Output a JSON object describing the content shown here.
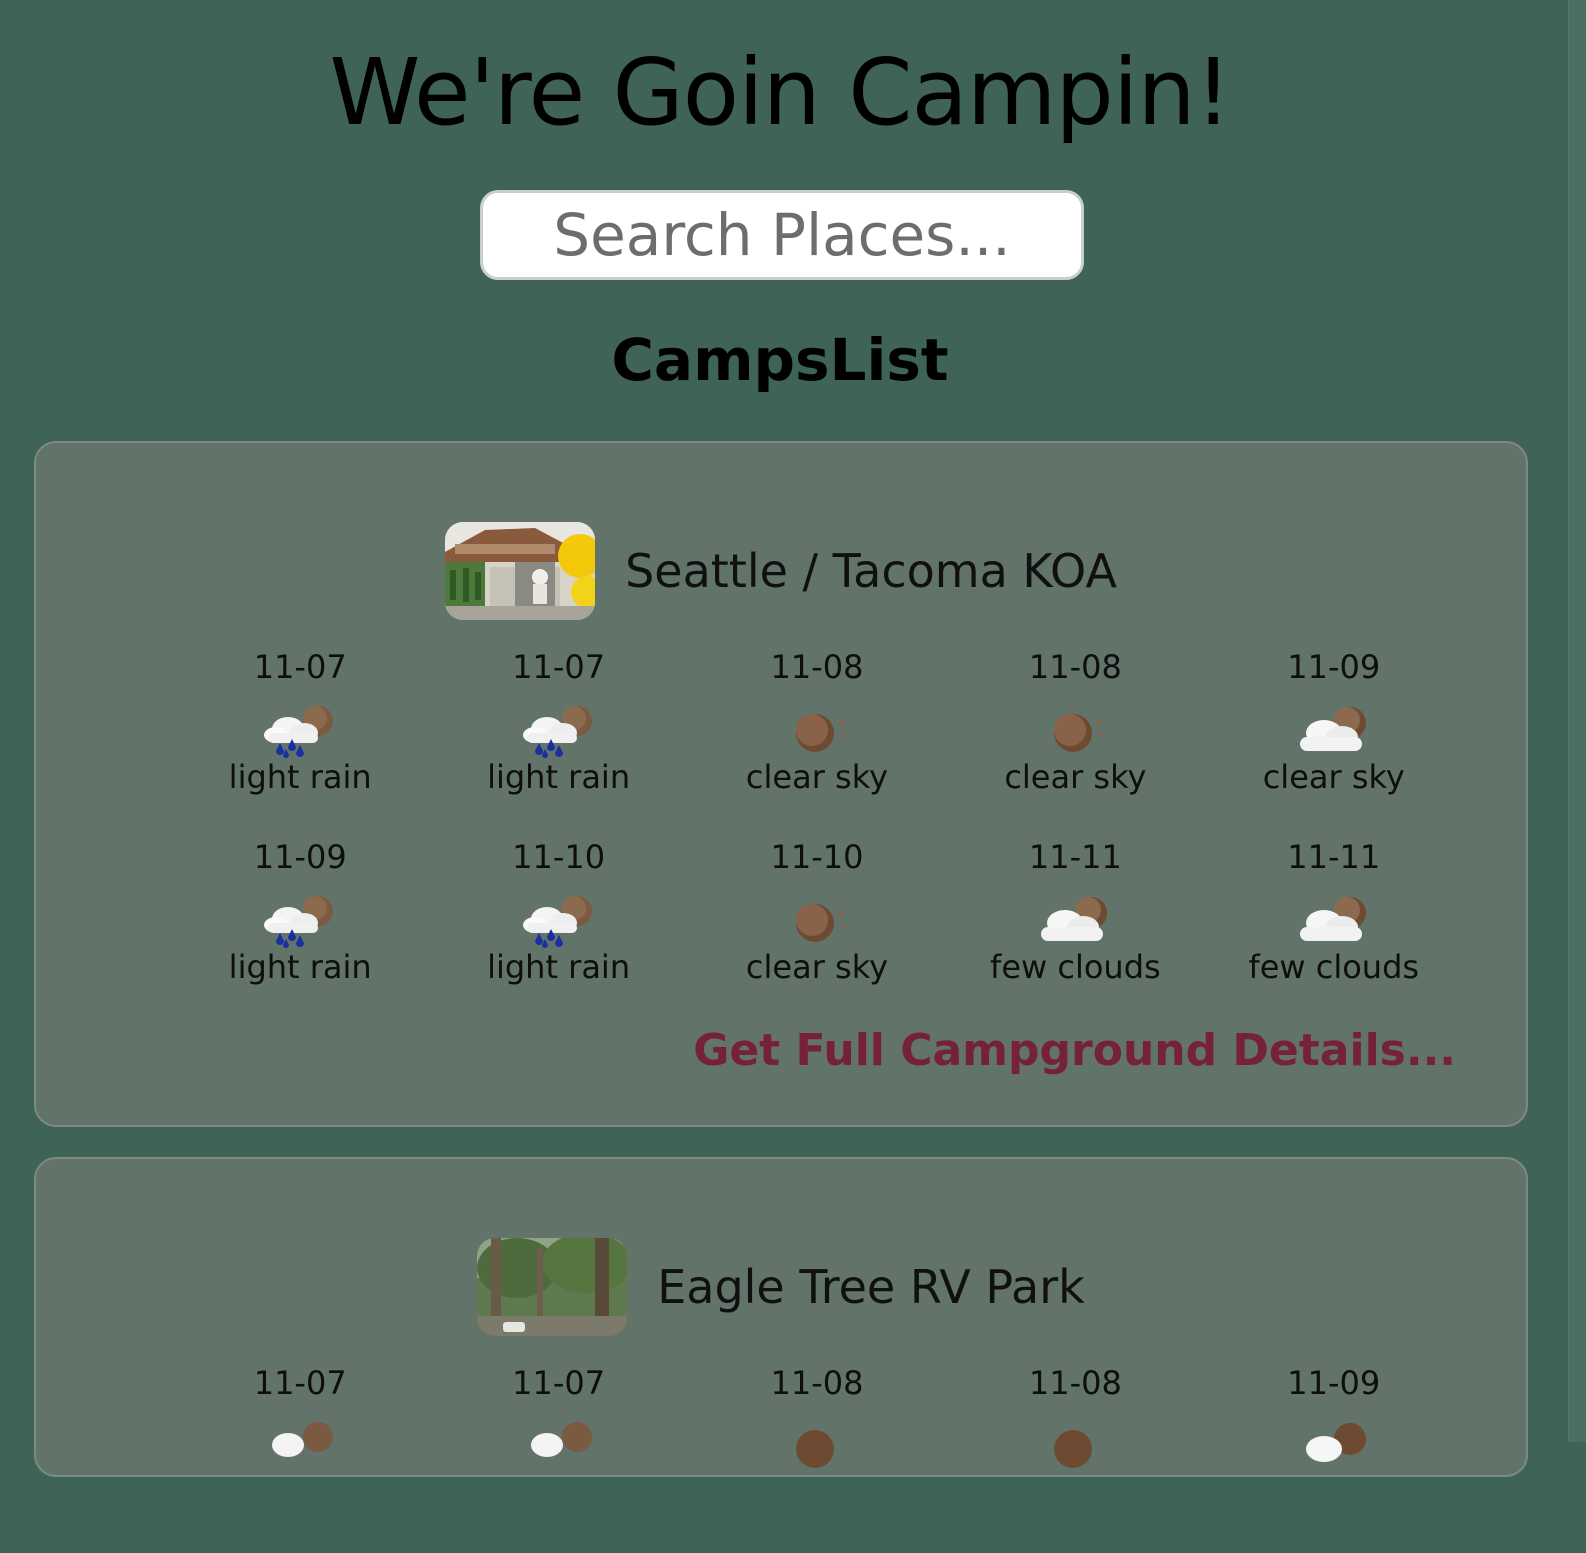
{
  "header": {
    "title": "We're Goin Campin!"
  },
  "search": {
    "placeholder": "Search Places..."
  },
  "list": {
    "title": "CampsList"
  },
  "camps": [
    {
      "name": "Seattle / Tacoma KOA",
      "link_label": "Get Full Campground Details...",
      "forecast": [
        {
          "date": "11-07",
          "desc": "light rain",
          "icon": "rain-icon"
        },
        {
          "date": "11-07",
          "desc": "light rain",
          "icon": "rain-icon"
        },
        {
          "date": "11-08",
          "desc": "clear sky",
          "icon": "clear-night-icon"
        },
        {
          "date": "11-08",
          "desc": "clear sky",
          "icon": "clear-night-icon"
        },
        {
          "date": "11-09",
          "desc": "clear sky",
          "icon": "cloud-moon-icon"
        },
        {
          "date": "11-09",
          "desc": "light rain",
          "icon": "rain-icon"
        },
        {
          "date": "11-10",
          "desc": "light rain",
          "icon": "rain-icon"
        },
        {
          "date": "11-10",
          "desc": "clear sky",
          "icon": "clear-night-icon"
        },
        {
          "date": "11-11",
          "desc": "few clouds",
          "icon": "cloud-moon-icon"
        },
        {
          "date": "11-11",
          "desc": "few clouds",
          "icon": "cloud-moon-icon"
        }
      ]
    },
    {
      "name": "Eagle Tree RV Park",
      "forecast": [
        {
          "date": "11-07"
        },
        {
          "date": "11-07"
        },
        {
          "date": "11-08"
        },
        {
          "date": "11-08"
        },
        {
          "date": "11-09"
        }
      ]
    }
  ],
  "colors": {
    "page_background": "#3f6457",
    "card_background": "#627369",
    "link": "#76213a"
  }
}
